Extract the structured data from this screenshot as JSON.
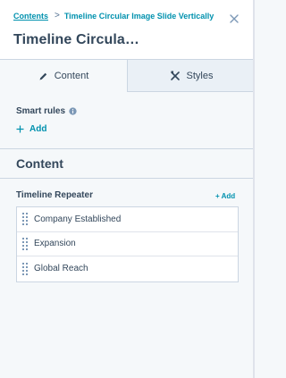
{
  "breadcrumb": {
    "parent": "Contents",
    "separator": ">",
    "current": "Timeline Circular Image Slide Vertically"
  },
  "title": "Timeline Circula…",
  "tabs": [
    {
      "label": "Content",
      "icon": "pencil-icon",
      "active": true
    },
    {
      "label": "Styles",
      "icon": "styles-icon",
      "active": false
    }
  ],
  "smart_rules": {
    "label": "Smart rules",
    "add_label": "Add"
  },
  "section_title": "Content",
  "repeater": {
    "label": "Timeline Repeater",
    "add_label": "+ Add",
    "items": [
      {
        "label": "Company Established"
      },
      {
        "label": "Expansion"
      },
      {
        "label": "Global Reach"
      }
    ]
  },
  "colors": {
    "accent": "#0091ae",
    "text": "#33475b",
    "border": "#cbd6e2",
    "background": "#f5f8fa"
  }
}
